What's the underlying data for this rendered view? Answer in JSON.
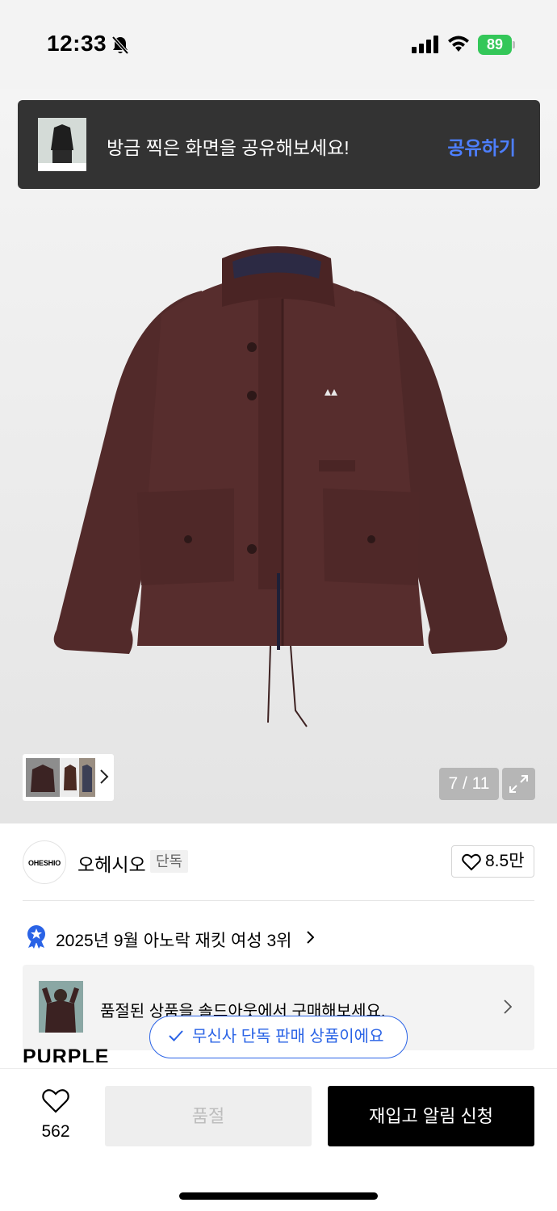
{
  "status_bar": {
    "time": "12:33",
    "battery": "89",
    "icons": [
      "bell-slash-icon",
      "cellular-signal-icon",
      "wifi-icon",
      "battery-charging-icon"
    ]
  },
  "share_toast": {
    "message": "방금 찍은 화면을 공유해보세요!",
    "action": "공유하기",
    "action_color": "#4d7fff"
  },
  "gallery": {
    "counter": "7 / 11",
    "expand_icon": "expand-arrows-icon",
    "thumbnails_icon": "chevron-right-icon"
  },
  "brand": {
    "logo_text": "OHESHIO",
    "name": "오헤시오",
    "badge": "단독",
    "likes": "8.5만"
  },
  "ranking": {
    "text": "2025년 9월 아노락 재킷 여성 3위",
    "badge_color": "#2a63e6"
  },
  "soldout_banner": {
    "text": "품절된 상품을 솔드아웃에서 구매해보세요."
  },
  "variant": {
    "label": "PURPLE"
  },
  "exclusive_toast": {
    "text": "무신사 단독 판매 상품이에요",
    "color": "#2a63e6"
  },
  "bottom_bar": {
    "wishlist_count": "562",
    "soldout_button": "품절",
    "restock_button": "재입고 알림 신청"
  }
}
